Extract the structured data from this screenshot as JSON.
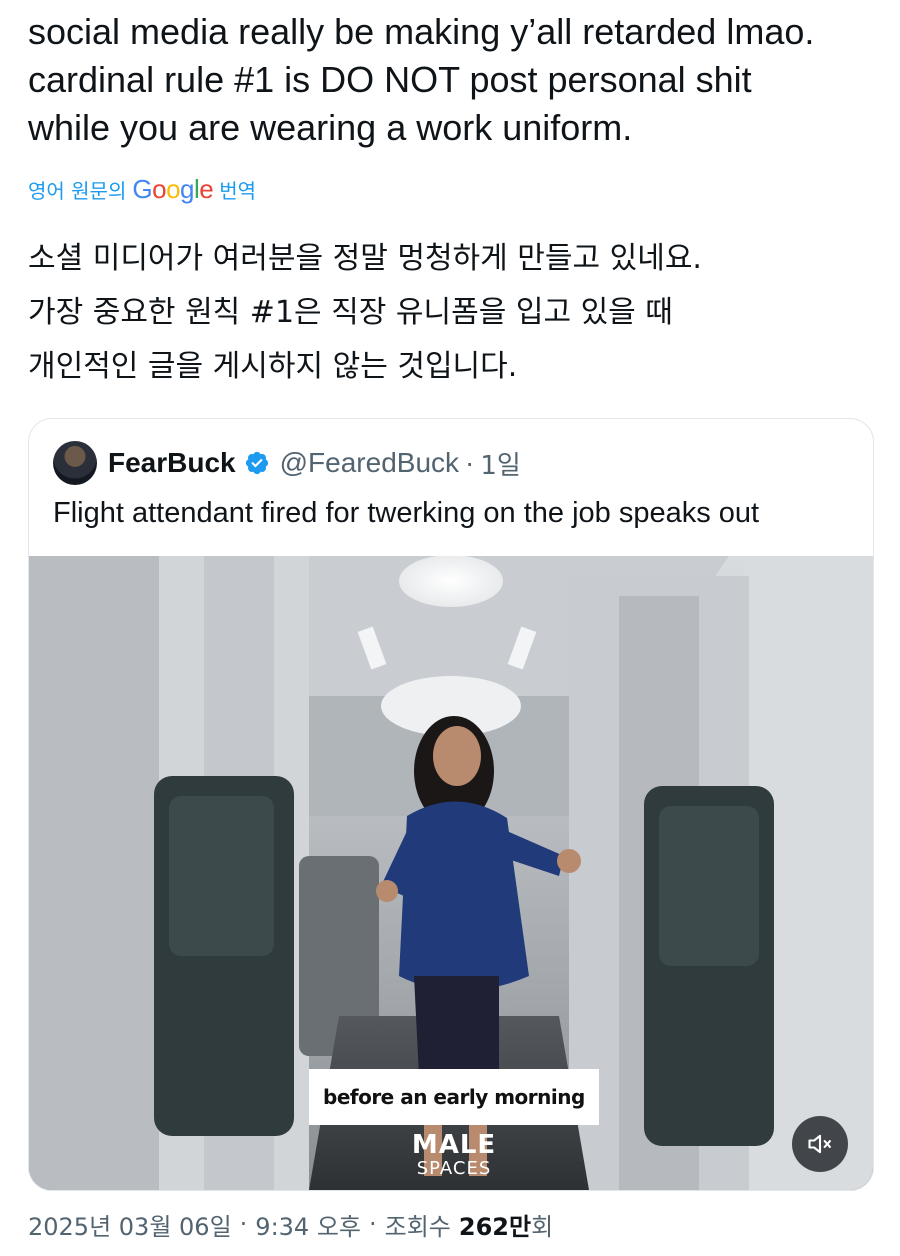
{
  "tweet": {
    "text": "social media really be making y’all retarded lmao.\ncardinal rule #1 is DO NOT post personal shit\nwhile you are wearing a work uniform.",
    "translate": {
      "prefix": "영어 원문의",
      "google_logo_letters": [
        "G",
        "o",
        "o",
        "g",
        "l",
        "e"
      ],
      "suffix": "번역"
    },
    "translated_text": "소셜 미디어가 여러분을 정말 멍청하게 만들고 있네요.\n가장 중요한 원칙 #1은 직장 유니폼을 입고 있을 때\n개인적인 글을 게시하지 않는 것입니다."
  },
  "quoted_tweet": {
    "display_name": "FearBuck",
    "verified": true,
    "handle": "@FearedBuck",
    "separator": "·",
    "time": "1일",
    "text": "Flight attendant fired for twerking on the job speaks out",
    "video": {
      "subtitle": "before an early morning",
      "watermark_line1": "MALE",
      "watermark_line2": "SPACES",
      "mute_icon": "speaker-muted-icon"
    }
  },
  "meta": {
    "date": "2025년 03월 06일",
    "sep1": "·",
    "time": "9:34 오후",
    "sep2": "·",
    "views_label": "조회수",
    "views_count": "262만",
    "views_suffix": "회"
  },
  "colors": {
    "link_blue": "#1d9bf0",
    "verified_blue": "#1d9bf0",
    "text_primary": "#0f1419",
    "text_secondary": "#536471",
    "border": "#e1e6ea"
  }
}
